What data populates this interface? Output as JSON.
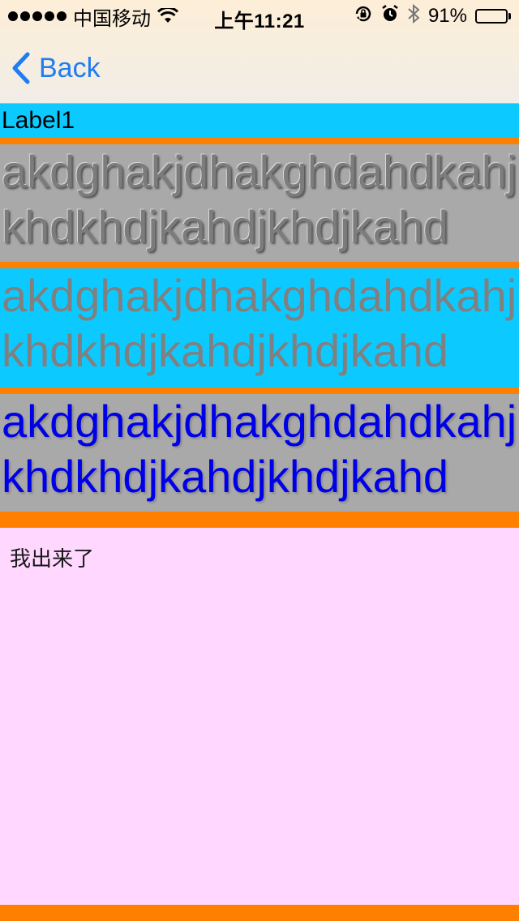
{
  "status_bar": {
    "carrier": "中国移动",
    "time": "上午11:21",
    "battery_percent": "91%",
    "battery_level": 0.91,
    "icons": [
      "signal-dots-icon",
      "wifi-icon",
      "orientation-lock-icon",
      "alarm-icon",
      "bluetooth-icon",
      "battery-icon"
    ]
  },
  "nav": {
    "back_label": "Back",
    "back_icon": "chevron-left-icon"
  },
  "content": {
    "label1": "Label1",
    "block1_text": "akdghakjdhakghdahdkahjkhdkhdjkahdjkhdjkahd",
    "block2_text": "akdghakjdhakghdahdkahjkhdkhdjkahdjkhdjkahd",
    "block3_text": "akdghakjdhakghdahdkahjkhdkhdjkahdjkhdjkahd",
    "pink_text": "我出来了"
  },
  "colors": {
    "accent_blue": "#1e7df2",
    "cyan": "#0ccaff",
    "orange": "#ff8000",
    "gray": "#a9a9a9",
    "pink": "#ffd7ff",
    "blue_text": "#0000e8",
    "battery_green": "#4cd964"
  }
}
